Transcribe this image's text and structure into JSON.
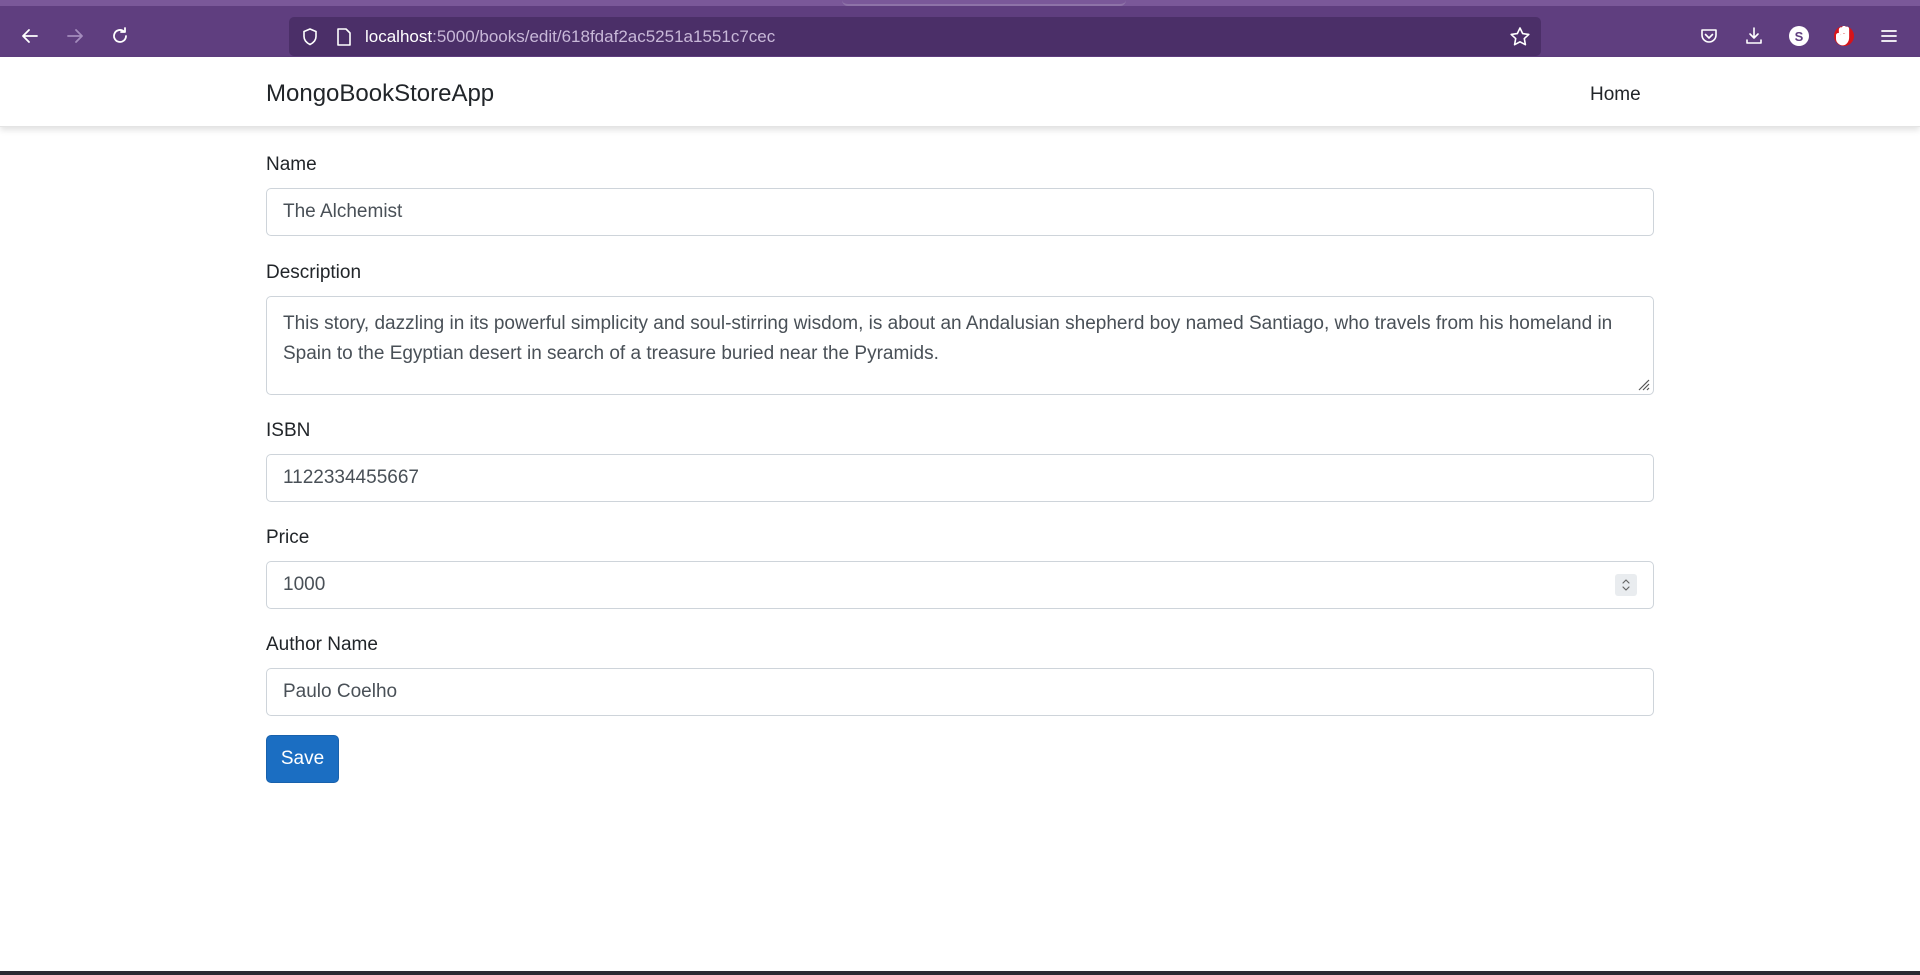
{
  "browser": {
    "url_host": "localhost",
    "url_rest": ":5000/books/edit/618fdaf2ac5251a1551c7cec",
    "profile_letter": "S"
  },
  "app": {
    "brand": "MongoBookStoreApp",
    "nav": {
      "home": "Home"
    }
  },
  "form": {
    "name": {
      "label": "Name",
      "value": "The Alchemist"
    },
    "description": {
      "label": "Description",
      "value": "This story, dazzling in its powerful simplicity and soul-stirring wisdom, is about an Andalusian shepherd boy named Santiago, who travels from his homeland in Spain to the Egyptian desert in search of a treasure buried near the Pyramids."
    },
    "isbn": {
      "label": "ISBN",
      "value": "1122334455667"
    },
    "price": {
      "label": "Price",
      "value": "1000"
    },
    "author": {
      "label": "Author Name",
      "value": "Paulo Coelho"
    },
    "save_label": "Save"
  },
  "colors": {
    "chrome": "#5f3e7f",
    "urlbar": "#4b2f68",
    "primary_button": "#1b6ec2"
  }
}
